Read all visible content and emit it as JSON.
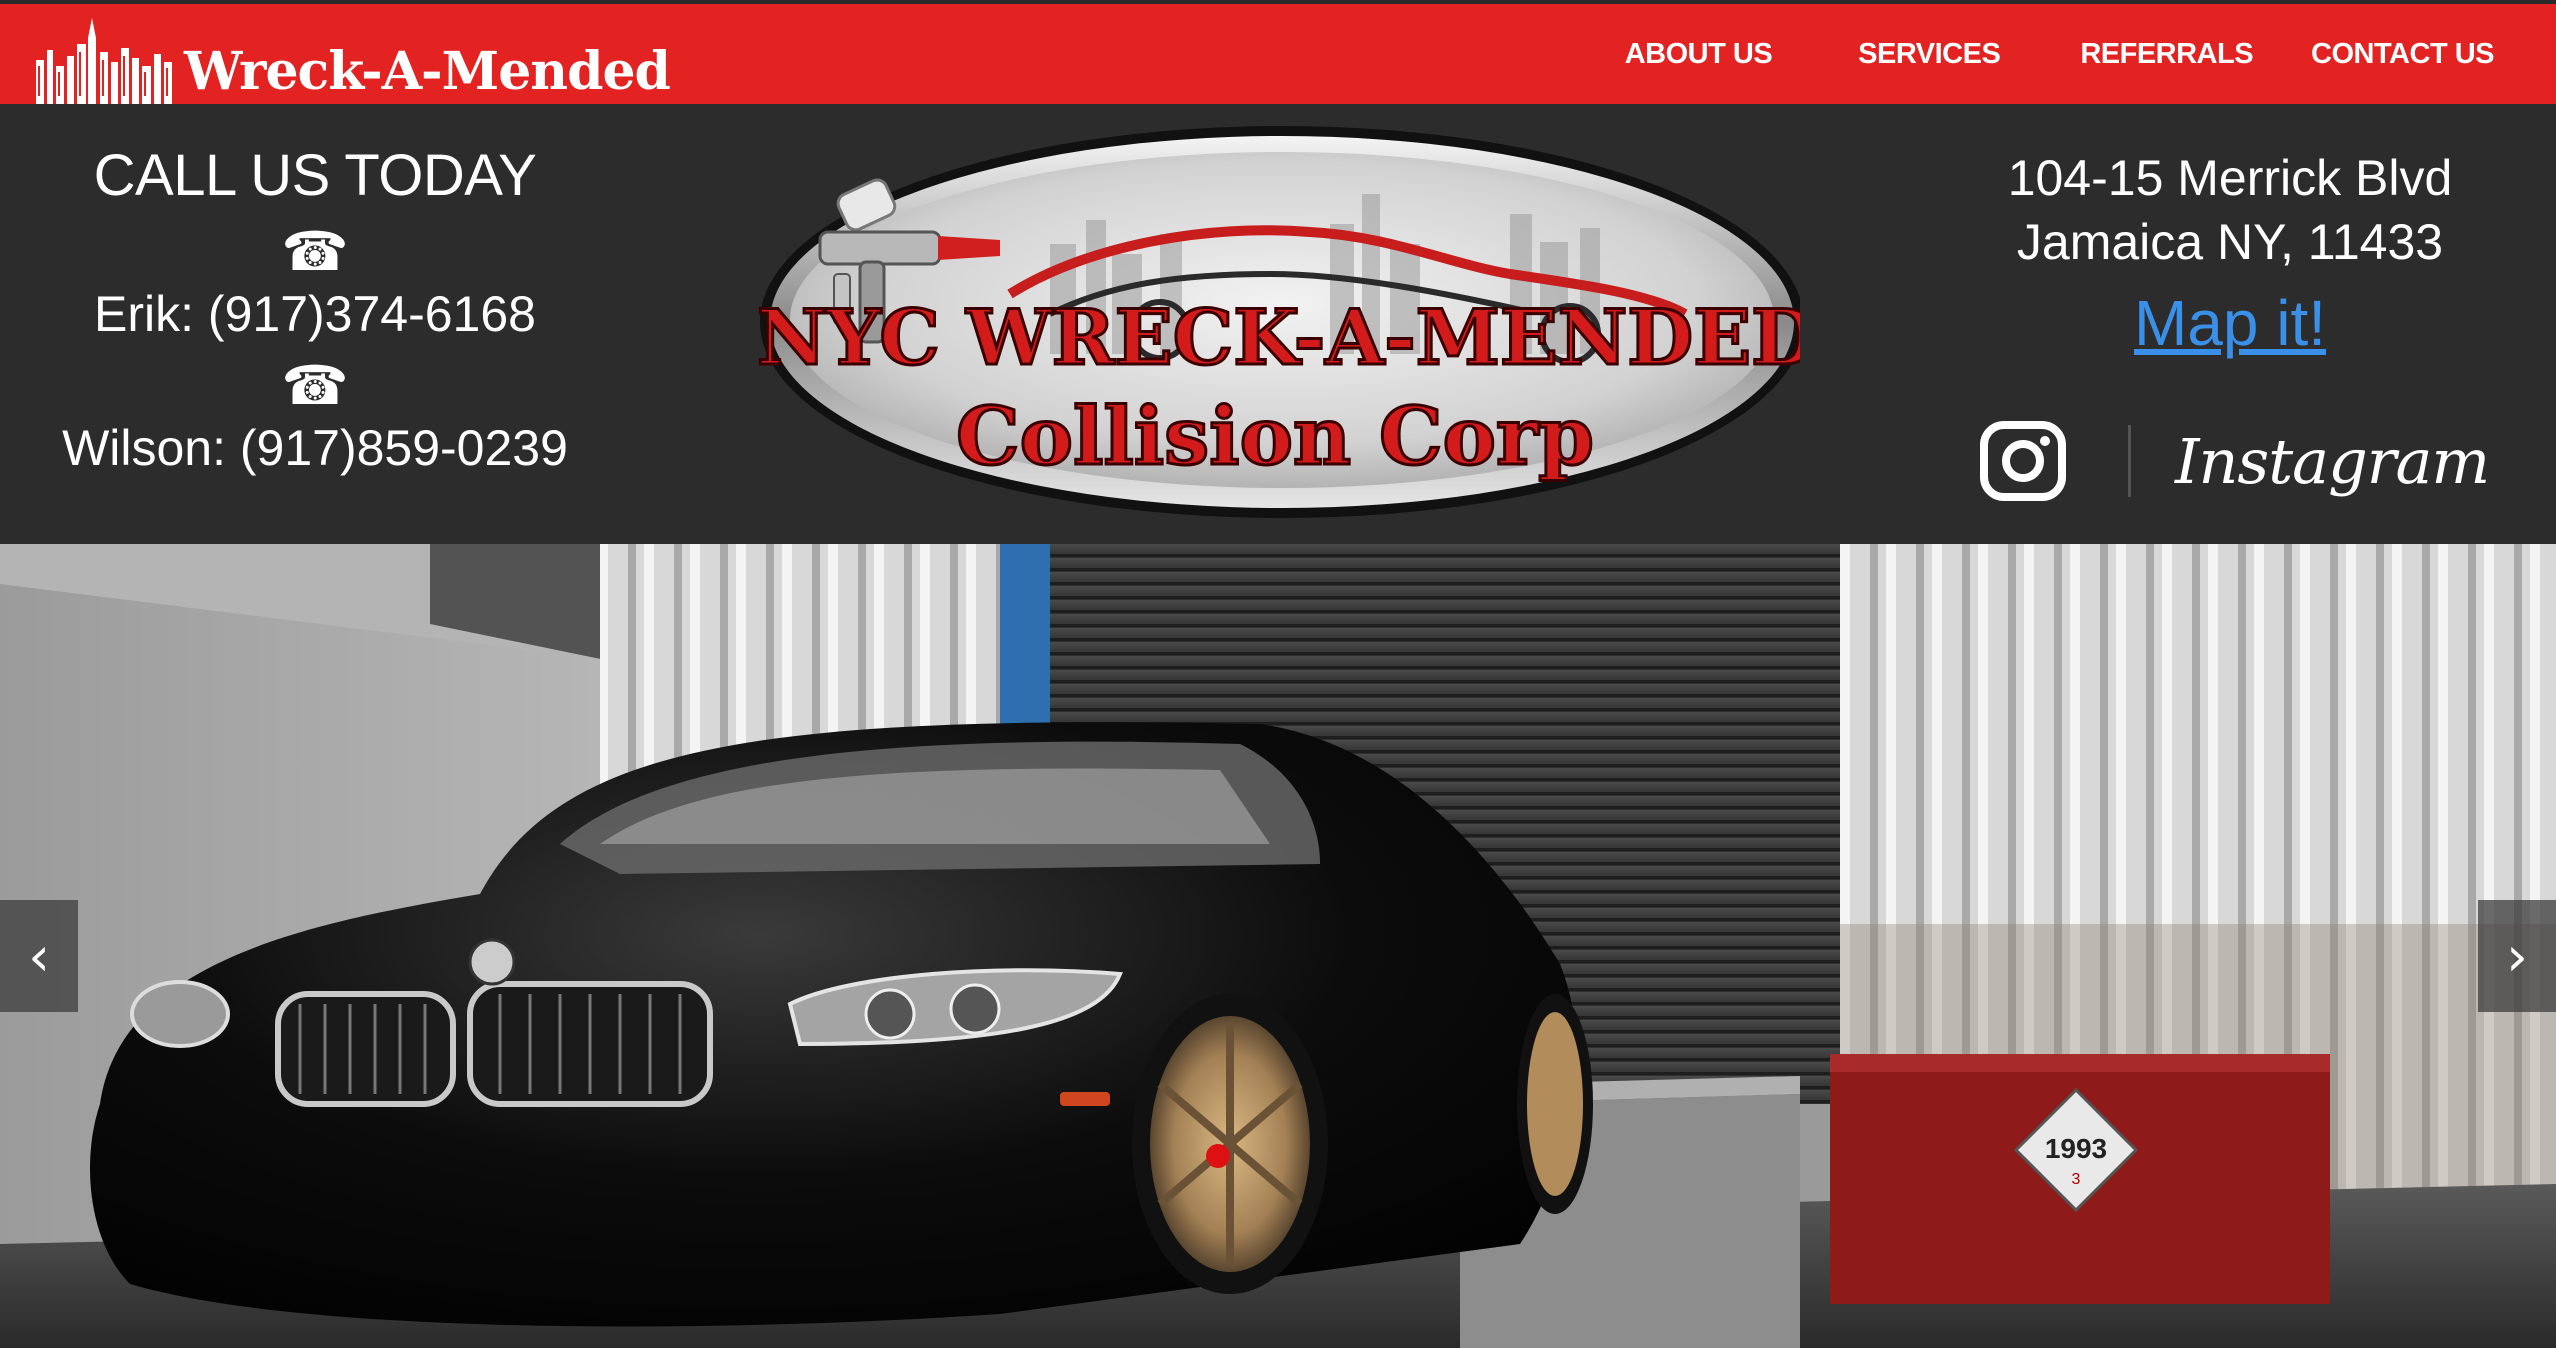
{
  "brand": {
    "name": "Wreck-A-Mended"
  },
  "nav": {
    "items": [
      "ABOUT US",
      "SERVICES",
      "REFERRALS",
      "CONTACT US"
    ]
  },
  "call": {
    "title": "CALL US TODAY",
    "phones": [
      "Erik: (917)374-6168",
      "Wilson: (917)859-0239"
    ],
    "phone_icon": "telephone-icon"
  },
  "logo": {
    "line1": "NYC WRECK-A-MENDED",
    "line2": "Collision Corp"
  },
  "address": {
    "line1": "104-15 Merrick Blvd",
    "line2": "Jamaica NY, 11433",
    "map_link": "Map it!"
  },
  "social": {
    "label": "Instagram",
    "icon": "instagram-icon"
  },
  "slider": {
    "prev_label": "‹",
    "next_label": "›",
    "sign_text": "1993",
    "sign_sub": "3"
  },
  "colors": {
    "brand_red": "#e32222",
    "header_bg": "#2c2c2c",
    "link_blue": "#3a8fe8"
  }
}
